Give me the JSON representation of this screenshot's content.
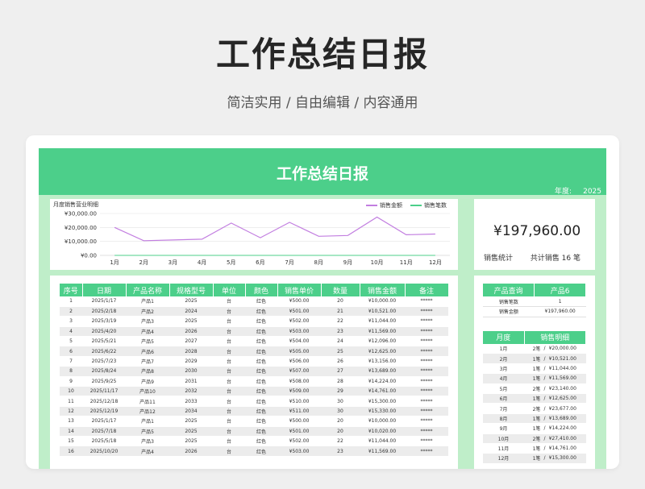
{
  "header": {
    "title": "工作总结日报",
    "subtitle": "简洁实用 / 自由编辑 / 内容通用"
  },
  "sheet": {
    "title": "工作总结日报",
    "year_label": "年度:",
    "year_value": "2025"
  },
  "colors": {
    "accent": "#4ccf8a",
    "sheet_bg": "#bfeec9",
    "series_amount": "#c27ee0",
    "series_count": "#4ccf8a"
  },
  "chart_data": {
    "type": "line",
    "title": "月度销售营业明细",
    "categories": [
      "1月",
      "2月",
      "3月",
      "4月",
      "5月",
      "6月",
      "7月",
      "8月",
      "9月",
      "10月",
      "11月",
      "12月"
    ],
    "series": [
      {
        "name": "销售金额",
        "values": [
          20000,
          10521,
          11044,
          11569,
          23140,
          12625,
          23677,
          13689,
          14224,
          27410,
          14761,
          15300
        ]
      },
      {
        "name": "销售笔数",
        "values": [
          2,
          1,
          1,
          1,
          2,
          1,
          2,
          1,
          1,
          2,
          1,
          1
        ]
      }
    ],
    "y_ticks": [
      "¥0.00",
      "¥10,000.00",
      "¥20,000.00",
      "¥30,000.00"
    ],
    "ylim": [
      0,
      30000
    ],
    "legend_position": "top-right",
    "grid": true
  },
  "summary": {
    "total_amount": "¥197,960.00",
    "stat_label": "销售统计",
    "count_text": "共计销售  16  笔"
  },
  "main_table": {
    "headers": [
      "序号",
      "日期",
      "产品名称",
      "规格型号",
      "单位",
      "颜色",
      "销售单价",
      "数量",
      "销售金额",
      "备注"
    ],
    "rows": [
      [
        "1",
        "2025/1/17",
        "产品1",
        "2025",
        "台",
        "红色",
        "¥500.00",
        "20",
        "¥10,000.00",
        "*****"
      ],
      [
        "2",
        "2025/2/18",
        "产品2",
        "2024",
        "台",
        "红色",
        "¥501.00",
        "21",
        "¥10,521.00",
        "*****"
      ],
      [
        "3",
        "2025/3/19",
        "产品3",
        "2025",
        "台",
        "红色",
        "¥502.00",
        "22",
        "¥11,044.00",
        "*****"
      ],
      [
        "4",
        "2025/4/20",
        "产品4",
        "2026",
        "台",
        "红色",
        "¥503.00",
        "23",
        "¥11,569.00",
        "*****"
      ],
      [
        "5",
        "2025/5/21",
        "产品5",
        "2027",
        "台",
        "红色",
        "¥504.00",
        "24",
        "¥12,096.00",
        "*****"
      ],
      [
        "6",
        "2025/6/22",
        "产品6",
        "2028",
        "台",
        "红色",
        "¥505.00",
        "25",
        "¥12,625.00",
        "*****"
      ],
      [
        "7",
        "2025/7/23",
        "产品7",
        "2029",
        "台",
        "红色",
        "¥506.00",
        "26",
        "¥13,156.00",
        "*****"
      ],
      [
        "8",
        "2025/8/24",
        "产品8",
        "2030",
        "台",
        "红色",
        "¥507.00",
        "27",
        "¥13,689.00",
        "*****"
      ],
      [
        "9",
        "2025/9/25",
        "产品9",
        "2031",
        "台",
        "红色",
        "¥508.00",
        "28",
        "¥14,224.00",
        "*****"
      ],
      [
        "10",
        "2025/11/17",
        "产品10",
        "2032",
        "台",
        "红色",
        "¥509.00",
        "29",
        "¥14,761.00",
        "*****"
      ],
      [
        "11",
        "2025/12/18",
        "产品11",
        "2033",
        "台",
        "红色",
        "¥510.00",
        "30",
        "¥15,300.00",
        "*****"
      ],
      [
        "12",
        "2025/12/19",
        "产品12",
        "2034",
        "台",
        "红色",
        "¥511.00",
        "30",
        "¥15,330.00",
        "*****"
      ],
      [
        "13",
        "2025/1/17",
        "产品1",
        "2025",
        "台",
        "红色",
        "¥500.00",
        "20",
        "¥10,000.00",
        "*****"
      ],
      [
        "14",
        "2025/7/18",
        "产品5",
        "2025",
        "台",
        "红色",
        "¥501.00",
        "20",
        "¥10,020.00",
        "*****"
      ],
      [
        "15",
        "2025/5/18",
        "产品3",
        "2025",
        "台",
        "红色",
        "¥502.00",
        "22",
        "¥11,044.00",
        "*****"
      ],
      [
        "16",
        "2025/10/20",
        "产品4",
        "2026",
        "台",
        "红色",
        "¥503.00",
        "23",
        "¥11,569.00",
        "*****"
      ]
    ]
  },
  "query": {
    "label": "产品查询",
    "value": "产品6",
    "rows": [
      [
        "销售笔数",
        "1"
      ],
      [
        "销售金额",
        "¥197,960.00"
      ]
    ]
  },
  "monthly": {
    "headers": [
      "月度",
      "销售明细"
    ],
    "rows": [
      [
        "1月",
        "2笔",
        "/",
        "¥20,000.00"
      ],
      [
        "2月",
        "1笔",
        "/",
        "¥10,521.00"
      ],
      [
        "3月",
        "1笔",
        "/",
        "¥11,044.00"
      ],
      [
        "4月",
        "1笔",
        "/",
        "¥11,569.00"
      ],
      [
        "5月",
        "2笔",
        "/",
        "¥23,140.00"
      ],
      [
        "6月",
        "1笔",
        "/",
        "¥12,625.00"
      ],
      [
        "7月",
        "2笔",
        "/",
        "¥23,677.00"
      ],
      [
        "8月",
        "1笔",
        "/",
        "¥13,689.00"
      ],
      [
        "9月",
        "1笔",
        "/",
        "¥14,224.00"
      ],
      [
        "10月",
        "2笔",
        "/",
        "¥27,410.00"
      ],
      [
        "11月",
        "1笔",
        "/",
        "¥14,761.00"
      ],
      [
        "12月",
        "1笔",
        "/",
        "¥15,300.00"
      ]
    ]
  }
}
